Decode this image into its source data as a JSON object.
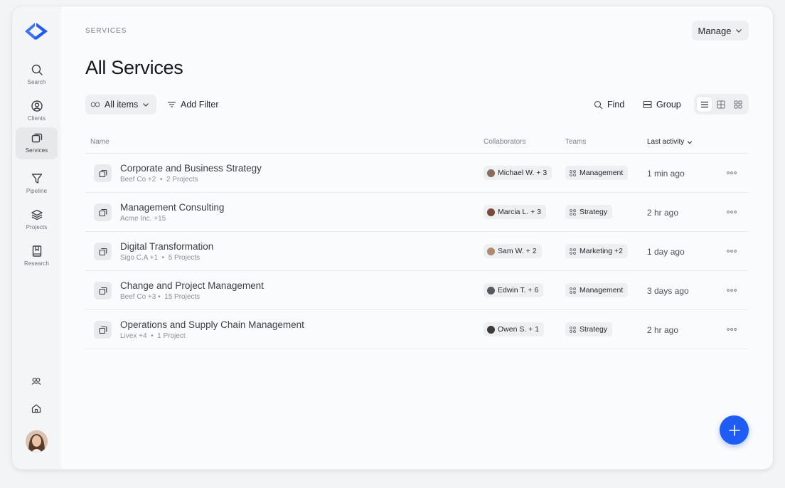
{
  "sidebar": {
    "logo": "app-logo",
    "items": [
      {
        "label": "Search",
        "icon": "search-icon"
      },
      {
        "label": "Clients",
        "icon": "user-circle-icon"
      },
      {
        "label": "Services",
        "icon": "copy-icon",
        "active": true
      },
      {
        "label": "Pipeline",
        "icon": "filter-icon"
      },
      {
        "label": "Projects",
        "icon": "layers-icon"
      },
      {
        "label": "Research",
        "icon": "book-icon"
      }
    ],
    "bottom_icons": [
      "team-icon",
      "home-icon"
    ]
  },
  "breadcrumb": "SERVICES",
  "manage_label": "Manage",
  "page_title": "All Services",
  "toolbar": {
    "all_items": "All items",
    "add_filter": "Add Filter",
    "find": "Find",
    "group": "Group",
    "views": [
      "list-view-icon",
      "grid-view-icon",
      "gallery-view-icon"
    ],
    "active_view": "list-view-icon"
  },
  "table": {
    "columns": {
      "name": "Name",
      "collaborators": "Collaborators",
      "teams": "Teams",
      "last_activity": "Last activity"
    },
    "rows": [
      {
        "title": "Corporate and Business Strategy",
        "client": "Beef Co +2",
        "projects": "2 Projects",
        "collaborators": "Michael W. + 3",
        "team": "Management",
        "activity": "1 min ago"
      },
      {
        "title": "Management Consulting",
        "client": "Acme Inc. +15",
        "projects": "",
        "collaborators": "Marcia L. + 3",
        "team": "Strategy",
        "activity": "2 hr ago"
      },
      {
        "title": "Digital Transformation",
        "client": "Sigo C.A +1",
        "projects": "5 Projects",
        "collaborators": "Sam W. + 2",
        "team": "Marketing +2",
        "activity": "1 day ago"
      },
      {
        "title": "Change and Project Management",
        "client": "Beef Co +3",
        "projects": "15 Projects",
        "collaborators": "Edwin T. + 6",
        "team": "Management",
        "activity": "3 days ago"
      },
      {
        "title": "Operations and Supply Chain Management",
        "client": "Livex +4",
        "projects": "1 Project",
        "collaborators": "Owen S. + 1",
        "team": "Strategy",
        "activity": "2 hr ago"
      }
    ]
  },
  "colors": {
    "accent": "#1f5cf5",
    "logo": "#1f5cf5"
  }
}
